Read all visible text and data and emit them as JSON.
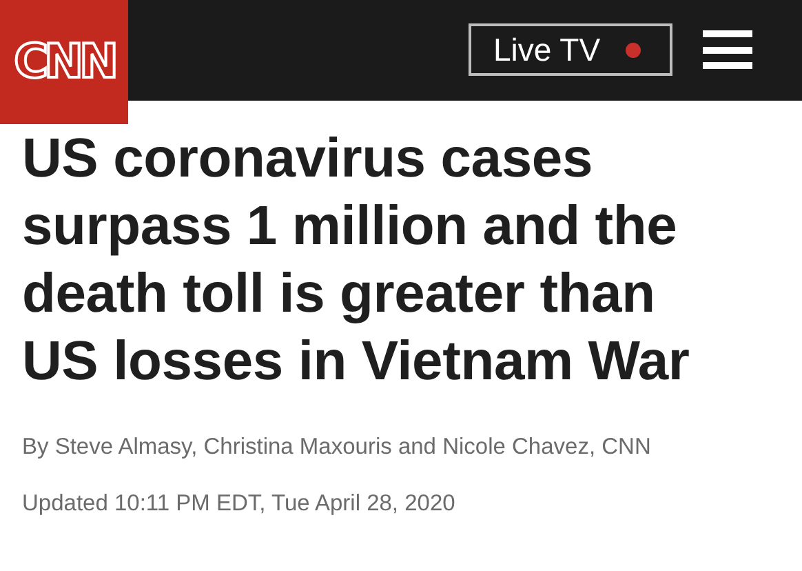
{
  "header": {
    "logo": "CNN",
    "live_button": {
      "label": "Live TV",
      "live": true
    }
  },
  "article": {
    "headline": "US coronavirus cases surpass 1 million and the death toll is greater than US losses in Vietnam War",
    "byline": "By Steve Almasy, Christina Maxouris and Nicole Chavez, CNN",
    "updated": "Updated 10:11 PM EDT, Tue April 28, 2020"
  }
}
